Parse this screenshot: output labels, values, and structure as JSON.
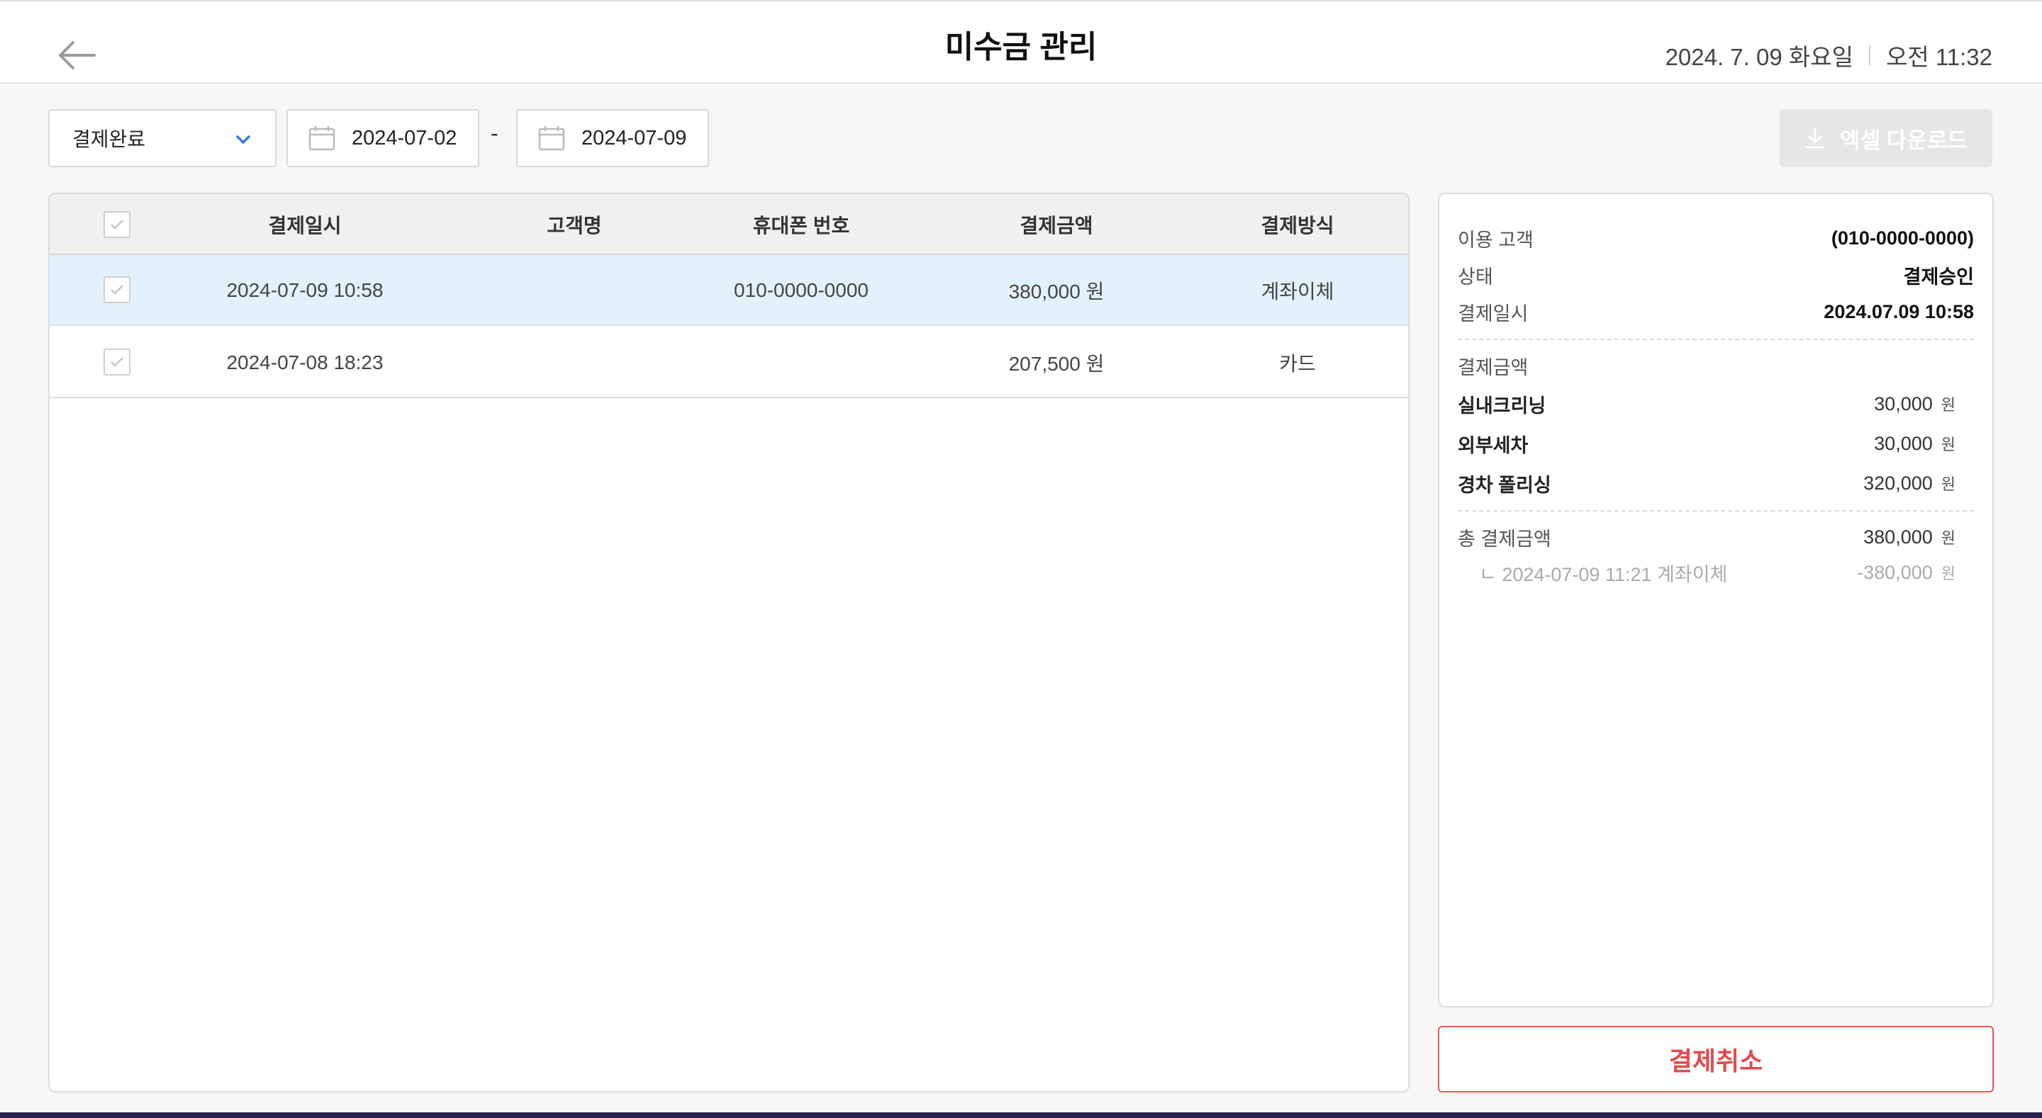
{
  "header": {
    "title": "미수금 관리",
    "date": "2024. 7. 09 화요일",
    "time": "오전 11:32"
  },
  "filters": {
    "status_value": "결제완료",
    "start_date": "2024-07-02",
    "date_separator": "-",
    "end_date": "2024-07-09",
    "excel_label": "엑셀 다운로드"
  },
  "table": {
    "columns": [
      "결제일시",
      "고객명",
      "휴대폰 번호",
      "결제금액",
      "결제방식"
    ],
    "rows": [
      {
        "datetime": "2024-07-09 10:58",
        "name": "",
        "phone": "010-0000-0000",
        "amount": "380,000 원",
        "method": "계좌이체",
        "selected": true
      },
      {
        "datetime": "2024-07-08 18:23",
        "name": "",
        "phone": "",
        "amount": "207,500 원",
        "method": "카드",
        "selected": false
      }
    ]
  },
  "detail": {
    "customer_label": "이용 고객",
    "customer_value": "(010-0000-0000)",
    "status_label": "상태",
    "status_value": "결제승인",
    "paid_at_label": "결제일시",
    "paid_at_value": "2024.07.09 10:58",
    "amount_section_label": "결제금액",
    "items": [
      {
        "name": "실내크리닝",
        "amount": "30,000",
        "unit": "원"
      },
      {
        "name": "외부세차",
        "amount": "30,000",
        "unit": "원"
      },
      {
        "name": "경차 폴리싱",
        "amount": "320,000",
        "unit": "원"
      }
    ],
    "total_label": "총 결제금액",
    "total_amount": "380,000",
    "total_unit": "원",
    "sub_payment_label": "ㄴ 2024-07-09 11:21 계좌이체",
    "sub_payment_amount": "-380,000",
    "sub_payment_unit": "원"
  },
  "actions": {
    "cancel_label": "결제취소"
  },
  "colors": {
    "accent_blue": "#2f7de1",
    "selected_row": "#e3f1fd",
    "danger": "#e34b4b"
  }
}
